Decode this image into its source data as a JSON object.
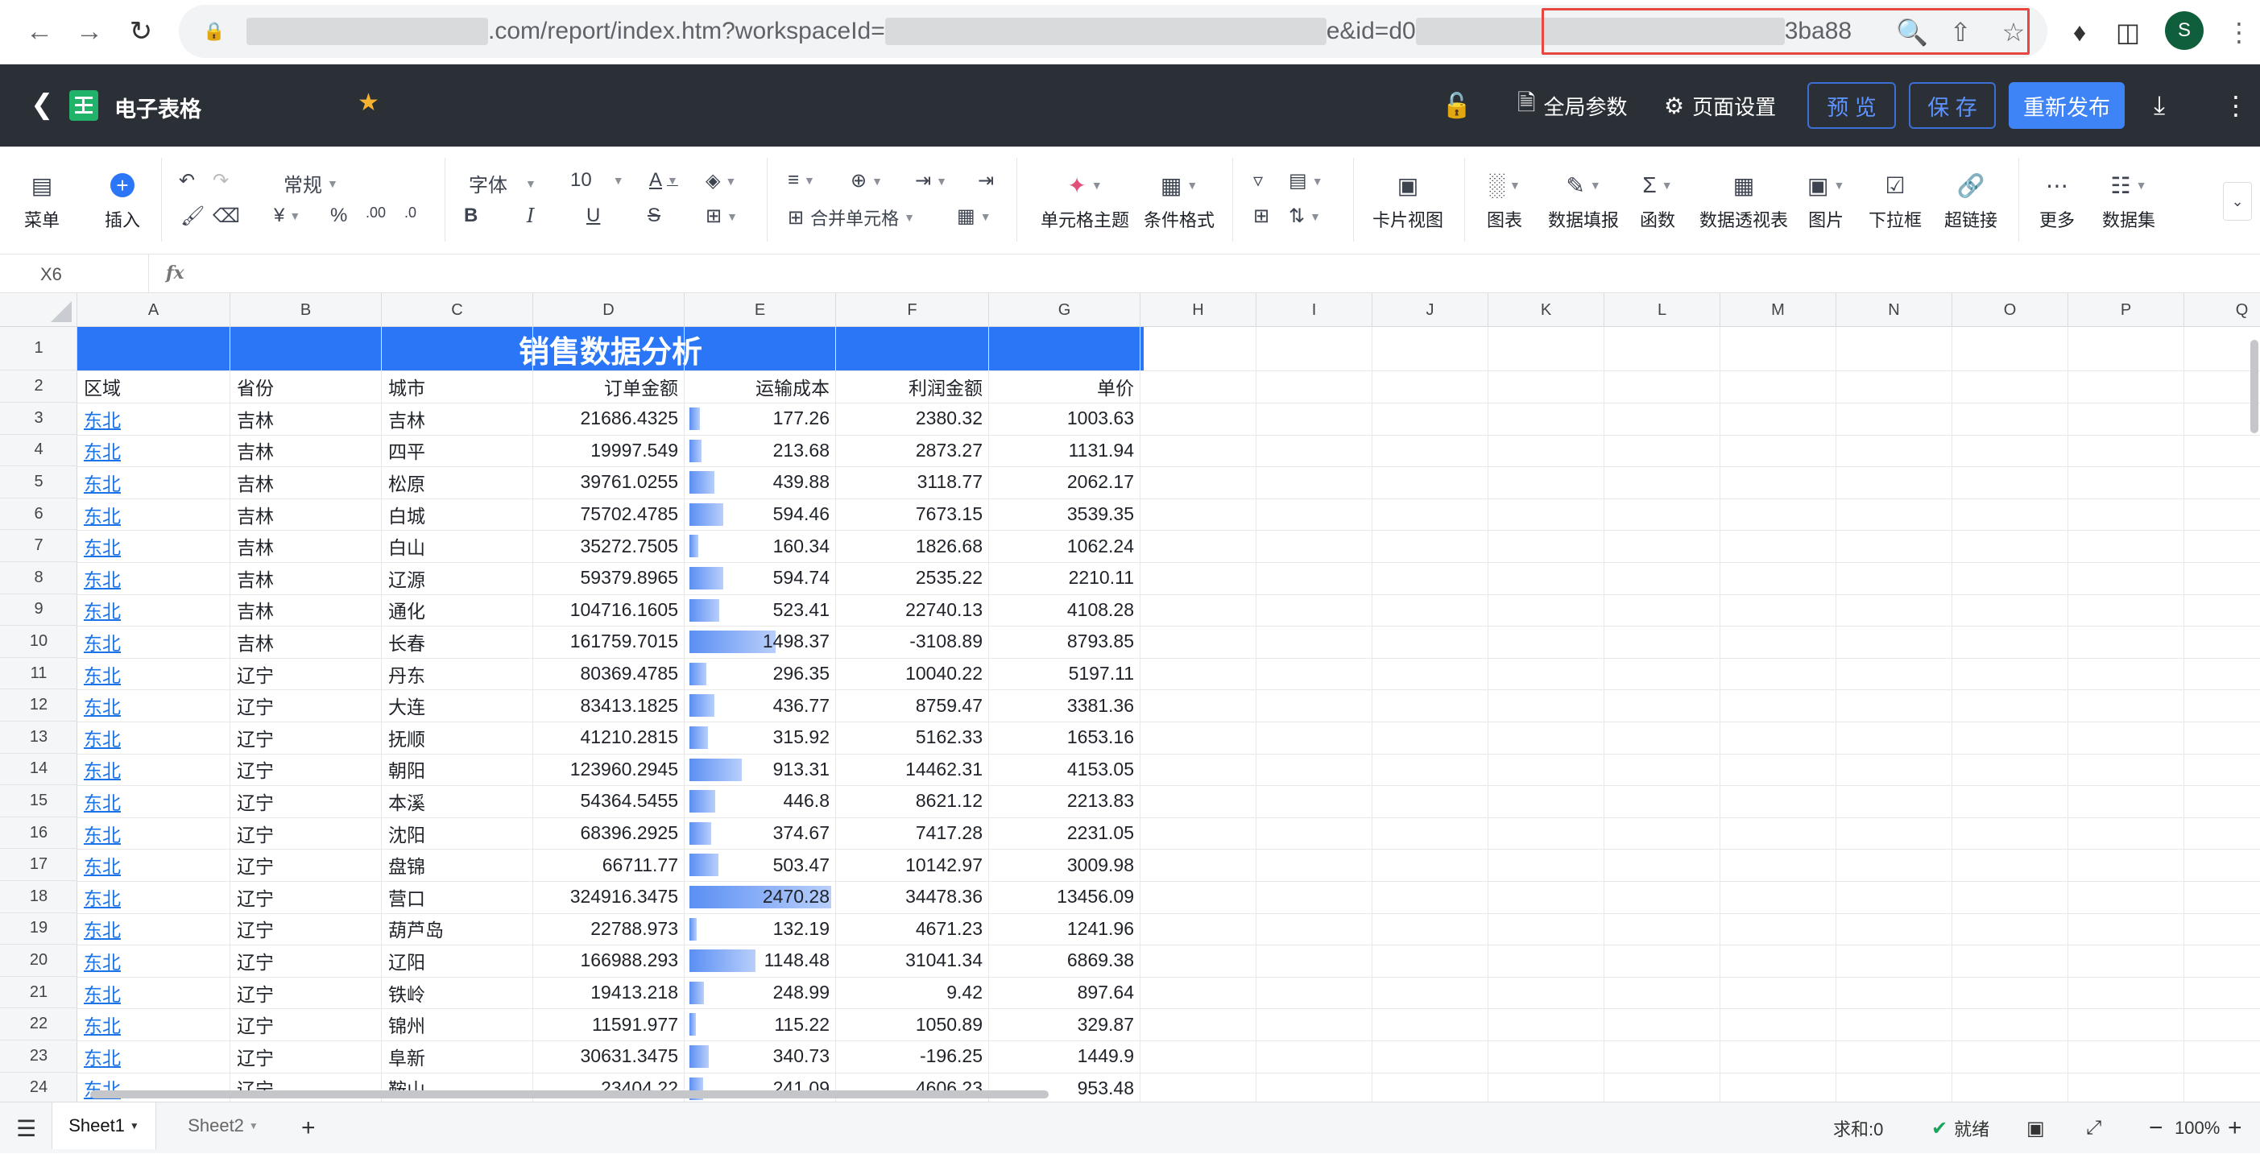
{
  "browser": {
    "url_visible_1": ".com/report/index.htm?workspaceId=",
    "url_visible_2": "e&id=",
    "url_visible_3": "d0",
    "url_visible_4": "3ba88",
    "profile_initial": "S"
  },
  "header": {
    "title": "电子表格",
    "global_params": "全局参数",
    "page_settings": "页面设置",
    "preview": "预 览",
    "save": "保 存",
    "republish": "重新发布"
  },
  "toolbar": {
    "menu": "菜单",
    "insert": "插入",
    "number_format": "常规",
    "font": "字体",
    "font_size": "10",
    "merge_cells": "合并单元格",
    "cell_theme": "单元格主题",
    "conditional_format": "条件格式",
    "card_view": "卡片视图",
    "chart": "图表",
    "data_fill": "数据填报",
    "function": "函数",
    "pivot": "数据透视表",
    "image": "图片",
    "dropdown": "下拉框",
    "hyperlink": "超链接",
    "more": "更多",
    "dataset": "数据集"
  },
  "formula": {
    "cell_ref": "X6",
    "fx": "fx"
  },
  "columns": [
    "A",
    "B",
    "C",
    "D",
    "E",
    "F",
    "G",
    "H",
    "I",
    "J",
    "K",
    "L",
    "M",
    "N",
    "O",
    "P",
    "Q"
  ],
  "rows": [
    "1",
    "2",
    "3",
    "4",
    "5",
    "6",
    "7",
    "8",
    "9",
    "10",
    "11",
    "12",
    "13",
    "14",
    "15",
    "16",
    "17",
    "18",
    "19",
    "20",
    "21",
    "22",
    "23",
    "24"
  ],
  "sheet": {
    "title": "销售数据分析",
    "headers": [
      "区域",
      "省份",
      "城市",
      "订单金额",
      "运输成本",
      "利润金额",
      "单价"
    ],
    "data": [
      [
        "东北",
        "吉林",
        "吉林",
        "21686.4325",
        "177.26",
        "2380.32",
        "1003.63"
      ],
      [
        "东北",
        "吉林",
        "四平",
        "19997.549",
        "213.68",
        "2873.27",
        "1131.94"
      ],
      [
        "东北",
        "吉林",
        "松原",
        "39761.0255",
        "439.88",
        "3118.77",
        "2062.17"
      ],
      [
        "东北",
        "吉林",
        "白城",
        "75702.4785",
        "594.46",
        "7673.15",
        "3539.35"
      ],
      [
        "东北",
        "吉林",
        "白山",
        "35272.7505",
        "160.34",
        "1826.68",
        "1062.24"
      ],
      [
        "东北",
        "吉林",
        "辽源",
        "59379.8965",
        "594.74",
        "2535.22",
        "2210.11"
      ],
      [
        "东北",
        "吉林",
        "通化",
        "104716.1605",
        "523.41",
        "22740.13",
        "4108.28"
      ],
      [
        "东北",
        "吉林",
        "长春",
        "161759.7015",
        "1498.37",
        "-3108.89",
        "8793.85"
      ],
      [
        "东北",
        "辽宁",
        "丹东",
        "80369.4785",
        "296.35",
        "10040.22",
        "5197.11"
      ],
      [
        "东北",
        "辽宁",
        "大连",
        "83413.1825",
        "436.77",
        "8759.47",
        "3381.36"
      ],
      [
        "东北",
        "辽宁",
        "抚顺",
        "41210.2815",
        "315.92",
        "5162.33",
        "1653.16"
      ],
      [
        "东北",
        "辽宁",
        "朝阳",
        "123960.2945",
        "913.31",
        "14462.31",
        "4153.05"
      ],
      [
        "东北",
        "辽宁",
        "本溪",
        "54364.5455",
        "446.8",
        "8621.12",
        "2213.83"
      ],
      [
        "东北",
        "辽宁",
        "沈阳",
        "68396.2925",
        "374.67",
        "7417.28",
        "2231.05"
      ],
      [
        "东北",
        "辽宁",
        "盘锦",
        "66711.77",
        "503.47",
        "10142.97",
        "3009.98"
      ],
      [
        "东北",
        "辽宁",
        "营口",
        "324916.3475",
        "2470.28",
        "34478.36",
        "13456.09"
      ],
      [
        "东北",
        "辽宁",
        "葫芦岛",
        "22788.973",
        "132.19",
        "4671.23",
        "1241.96"
      ],
      [
        "东北",
        "辽宁",
        "辽阳",
        "166988.293",
        "1148.48",
        "31041.34",
        "6869.38"
      ],
      [
        "东北",
        "辽宁",
        "铁岭",
        "19413.218",
        "248.99",
        "9.42",
        "897.64"
      ],
      [
        "东北",
        "辽宁",
        "锦州",
        "11591.977",
        "115.22",
        "1050.89",
        "329.87"
      ],
      [
        "东北",
        "辽宁",
        "阜新",
        "30631.3475",
        "340.73",
        "-196.25",
        "1449.9"
      ],
      [
        "东北",
        "辽宁",
        "鞍山",
        "23404.22",
        "241.09",
        "4606.23",
        "953.48"
      ]
    ]
  },
  "status": {
    "sheet1": "Sheet1",
    "sheet2": "Sheet2",
    "add": "+",
    "sum": "求和:0",
    "ready": "就绪",
    "zoom": "100%"
  },
  "colors": {
    "accent": "#2a76f6",
    "header_bg": "#2b2f36",
    "link": "#1a73e8"
  }
}
